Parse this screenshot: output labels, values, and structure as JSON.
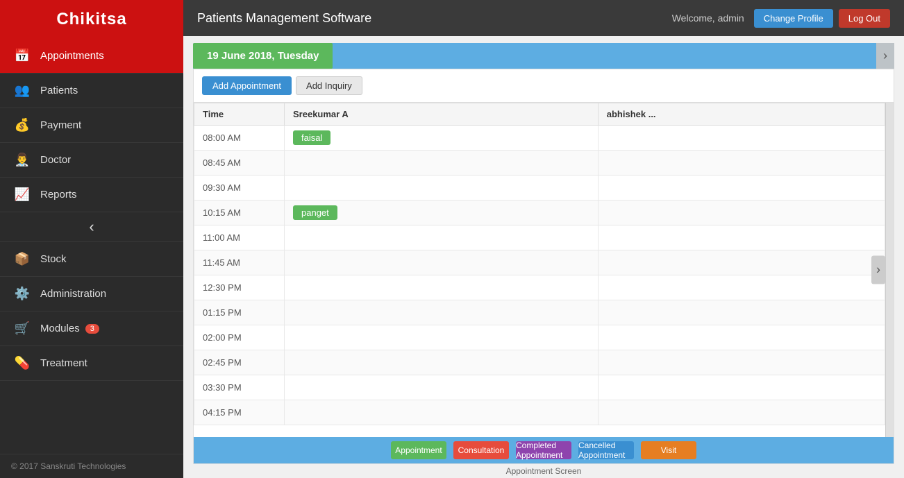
{
  "sidebar": {
    "logo": "Chikitsa",
    "items": [
      {
        "id": "appointments",
        "label": "Appointments",
        "icon": "📅",
        "active": true,
        "badge": null
      },
      {
        "id": "patients",
        "label": "Patients",
        "icon": "👥",
        "active": false,
        "badge": null
      },
      {
        "id": "payment",
        "label": "Payment",
        "icon": "💰",
        "active": false,
        "badge": null
      },
      {
        "id": "doctor",
        "label": "Doctor",
        "icon": "👨‍⚕️",
        "active": false,
        "badge": null
      },
      {
        "id": "reports",
        "label": "Reports",
        "icon": "📈",
        "active": false,
        "badge": null
      },
      {
        "id": "collapse",
        "label": "",
        "icon": "‹",
        "active": false,
        "badge": null
      },
      {
        "id": "stock",
        "label": "Stock",
        "icon": "📦",
        "active": false,
        "badge": null
      },
      {
        "id": "administration",
        "label": "Administration",
        "icon": "⚙️",
        "active": false,
        "badge": null
      },
      {
        "id": "modules",
        "label": "Modules",
        "icon": "🛒",
        "active": false,
        "badge": "3"
      },
      {
        "id": "treatment",
        "label": "Treatment",
        "icon": "💊",
        "active": false,
        "badge": null
      }
    ],
    "footer": "© 2017 Sanskruti Technologies"
  },
  "topbar": {
    "app_title": "Patients Management Software",
    "welcome_text": "Welcome, admin",
    "change_profile_label": "Change Profile",
    "logout_label": "Log Out"
  },
  "date_bar": {
    "date_label": "19 June 2018, Tuesday"
  },
  "toolbar": {
    "add_appointment_label": "Add Appointment",
    "add_inquiry_label": "Add Inquiry"
  },
  "schedule": {
    "columns": [
      "Time",
      "Sreekumar A",
      "abhishek ..."
    ],
    "rows": [
      {
        "time": "08:00 AM",
        "sreekumar": "faisal",
        "abhishek": ""
      },
      {
        "time": "08:45 AM",
        "sreekumar": "",
        "abhishek": ""
      },
      {
        "time": "09:30 AM",
        "sreekumar": "",
        "abhishek": ""
      },
      {
        "time": "10:15 AM",
        "sreekumar": "panget",
        "abhishek": ""
      },
      {
        "time": "11:00 AM",
        "sreekumar": "",
        "abhishek": ""
      },
      {
        "time": "11:45 AM",
        "sreekumar": "",
        "abhishek": ""
      },
      {
        "time": "12:30 PM",
        "sreekumar": "",
        "abhishek": ""
      },
      {
        "time": "01:15 PM",
        "sreekumar": "",
        "abhishek": ""
      },
      {
        "time": "02:00 PM",
        "sreekumar": "",
        "abhishek": ""
      },
      {
        "time": "02:45 PM",
        "sreekumar": "",
        "abhishek": ""
      },
      {
        "time": "03:30 PM",
        "sreekumar": "",
        "abhishek": ""
      },
      {
        "time": "04:15 PM",
        "sreekumar": "",
        "abhishek": ""
      }
    ]
  },
  "legend": {
    "items": [
      {
        "label": "Appointment",
        "color": "#5cb85c"
      },
      {
        "label": "Consultation",
        "color": "#e74c3c"
      },
      {
        "label": "Completed Appointment",
        "color": "#8e44ad"
      },
      {
        "label": "Cancelled Appointment",
        "color": "#3a8fd1"
      },
      {
        "label": "Visit",
        "color": "#e67e22"
      }
    ]
  },
  "footer_label": "Appointment Screen"
}
